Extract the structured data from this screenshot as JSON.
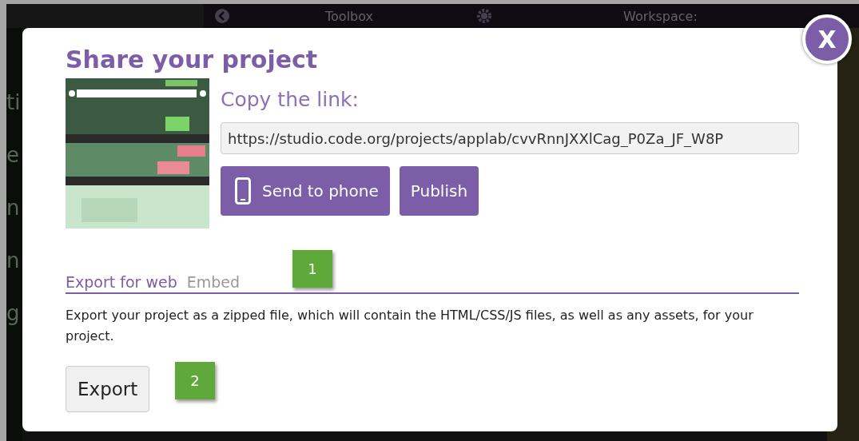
{
  "background": {
    "header": {
      "toolbox": "Toolbox",
      "workspace": "Workspace:"
    },
    "left_fragments": [
      "ti",
      "e",
      "n",
      "n",
      "g"
    ]
  },
  "dialog": {
    "title": "Share your project",
    "copy_heading": "Copy the link:",
    "url": "https://studio.code.org/projects/applab/cvvRnnJXXlCag_P0Za_JF_W8P",
    "send_button": "Send to phone",
    "publish_button": "Publish",
    "tabs": [
      {
        "label": "Export for web",
        "selected": true
      },
      {
        "label": "Embed",
        "selected": false
      }
    ],
    "description": "Export your project as a zipped file, which will contain the HTML/CSS/JS files, as well as any assets, for your project.",
    "export_button": "Export",
    "close": "X",
    "callouts": [
      "1",
      "2"
    ]
  }
}
